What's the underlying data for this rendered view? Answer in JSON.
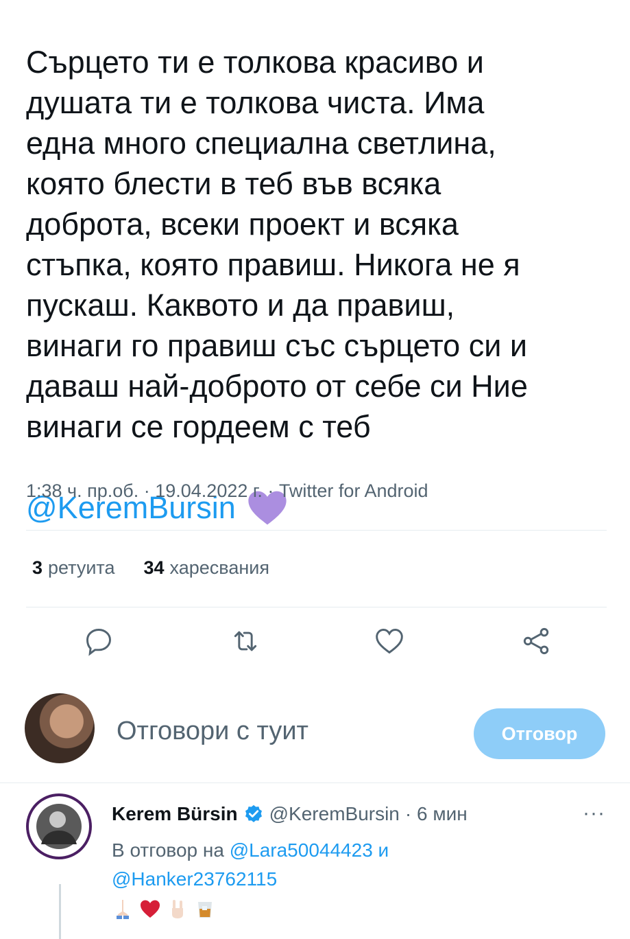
{
  "tweet": {
    "text": "Сърцето ти е толкова красиво и\nдушата ти е толкова чиста. Има\nедна много специална светлина,\nкоято блести в теб във всяка\nдоброта, всеки проект и всяка\nстъпка, която правиш. Никога не я\nпускаш. Каквото и да правиш,\nвинаги го правиш със сърцето си и\nдаваш най-доброто от себе си Ние\nвинаги се гордеем с теб",
    "mention": "@KeremBursin",
    "emoji": "purple-heart",
    "meta": "1:38 ч. пр.об. · 19.04.2022 г. · Twitter for Android"
  },
  "stats": {
    "retweets_count": "3",
    "retweets_label": "ретуита",
    "likes_count": "34",
    "likes_label": "харесвания"
  },
  "actions": [
    "reply-icon",
    "retweet-icon",
    "like-icon",
    "share-icon"
  ],
  "compose": {
    "placeholder": "Отговори с туит",
    "button_label": "Отговор"
  },
  "reply": {
    "name": "Kerem Bürsin",
    "handle": "@KeremBursin",
    "time": "· 6 мин",
    "more": "···",
    "replying_prefix": "В отговор на",
    "replying_to_1": "@Lara50044423",
    "replying_and": "и",
    "replying_to_2": "@Hanker23762115",
    "emojis": [
      "folded-hands",
      "red-heart",
      "rock-hand",
      "tumbler-glass"
    ]
  },
  "colors": {
    "accent": "#1d9bf0",
    "reply_button": "#8ecdf8",
    "heart_purple": "#ab8ee0",
    "text_secondary": "#536471"
  }
}
